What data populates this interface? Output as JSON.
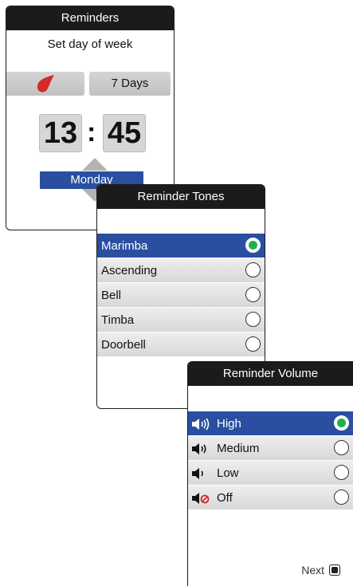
{
  "reminders": {
    "title": "Reminders",
    "subtitle": "Set day of week",
    "days_label": "7 Days",
    "time_hour": "13",
    "time_separator": ":",
    "time_minute": "45",
    "day": "Monday",
    "drop_icon": "blood-drop-icon",
    "drop_color": "#d42a2a"
  },
  "tones": {
    "title": "Reminder Tones",
    "items": [
      {
        "label": "Marimba",
        "selected": true
      },
      {
        "label": "Ascending",
        "selected": false
      },
      {
        "label": "Bell",
        "selected": false
      },
      {
        "label": "Timba",
        "selected": false
      },
      {
        "label": "Doorbell",
        "selected": false
      }
    ]
  },
  "volume": {
    "title": "Reminder Volume",
    "items": [
      {
        "label": "High",
        "icon": "speaker-high-icon",
        "selected": true
      },
      {
        "label": "Medium",
        "icon": "speaker-medium-icon",
        "selected": false
      },
      {
        "label": "Low",
        "icon": "speaker-low-icon",
        "selected": false
      },
      {
        "label": "Off",
        "icon": "speaker-off-icon",
        "selected": false
      }
    ],
    "next_label": "Next"
  },
  "colors": {
    "selection_blue": "#2a4fa0",
    "radio_green": "#20b04a",
    "titlebar": "#1b1b1b"
  }
}
